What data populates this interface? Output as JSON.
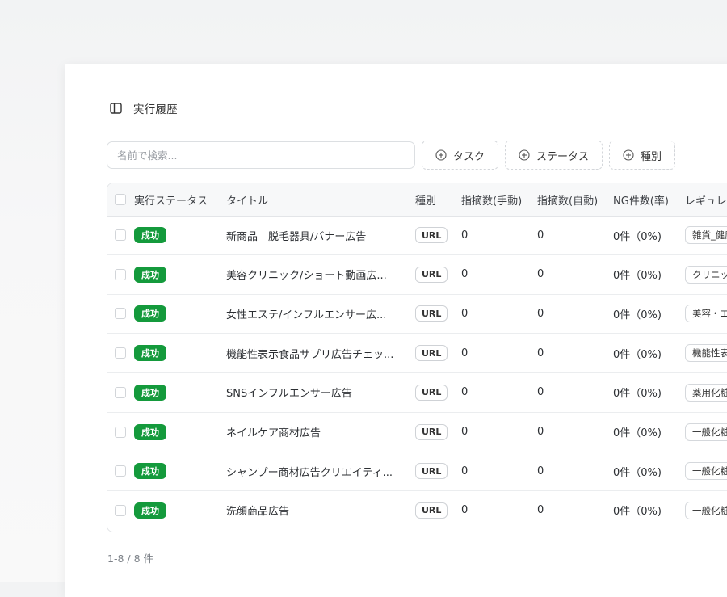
{
  "header": {
    "title": "実行履歴"
  },
  "search": {
    "placeholder": "名前で検索..."
  },
  "filters": [
    {
      "label": "タスク"
    },
    {
      "label": "ステータス"
    },
    {
      "label": "種別"
    }
  ],
  "table": {
    "columns": [
      "実行ステータス",
      "タイトル",
      "種別",
      "指摘数(手動)",
      "指摘数(自動)",
      "NG件数(率)",
      "レギュレ"
    ],
    "rows": [
      {
        "status": "成功",
        "title": "新商品　脱毛器具/バナー広告",
        "type": "URL",
        "manual": "0",
        "auto": "0",
        "ng": "0件（0%)",
        "regulation": "雑貨_健康"
      },
      {
        "status": "成功",
        "title": "美容クリニック/ショート動画広...",
        "type": "URL",
        "manual": "0",
        "auto": "0",
        "ng": "0件（0%)",
        "regulation": "クリニック"
      },
      {
        "status": "成功",
        "title": "女性エステ/インフルエンサー広...",
        "type": "URL",
        "manual": "0",
        "auto": "0",
        "ng": "0件（0%)",
        "regulation": "美容・エ"
      },
      {
        "status": "成功",
        "title": "機能性表示食品サプリ広告チェッ...",
        "type": "URL",
        "manual": "0",
        "auto": "0",
        "ng": "0件（0%)",
        "regulation": "機能性表"
      },
      {
        "status": "成功",
        "title": "SNSインフルエンサー広告",
        "type": "URL",
        "manual": "0",
        "auto": "0",
        "ng": "0件（0%)",
        "regulation": "薬用化粧"
      },
      {
        "status": "成功",
        "title": "ネイルケア商材広告",
        "type": "URL",
        "manual": "0",
        "auto": "0",
        "ng": "0件（0%)",
        "regulation": "一般化粧"
      },
      {
        "status": "成功",
        "title": "シャンプー商材広告クリエイティ...",
        "type": "URL",
        "manual": "0",
        "auto": "0",
        "ng": "0件（0%)",
        "regulation": "一般化粧"
      },
      {
        "status": "成功",
        "title": "洗顔商品広告",
        "type": "URL",
        "manual": "0",
        "auto": "0",
        "ng": "0件（0%)",
        "regulation": "一般化粧"
      }
    ]
  },
  "pagination": {
    "summary": "1-8 / 8 件"
  },
  "colors": {
    "success": "#149a3c",
    "border": "#e3e5e8",
    "header_bg": "#f7f8f9"
  },
  "icons": {
    "sidebar": "sidebar-toggle-icon",
    "filter": "plus-circle-icon"
  }
}
